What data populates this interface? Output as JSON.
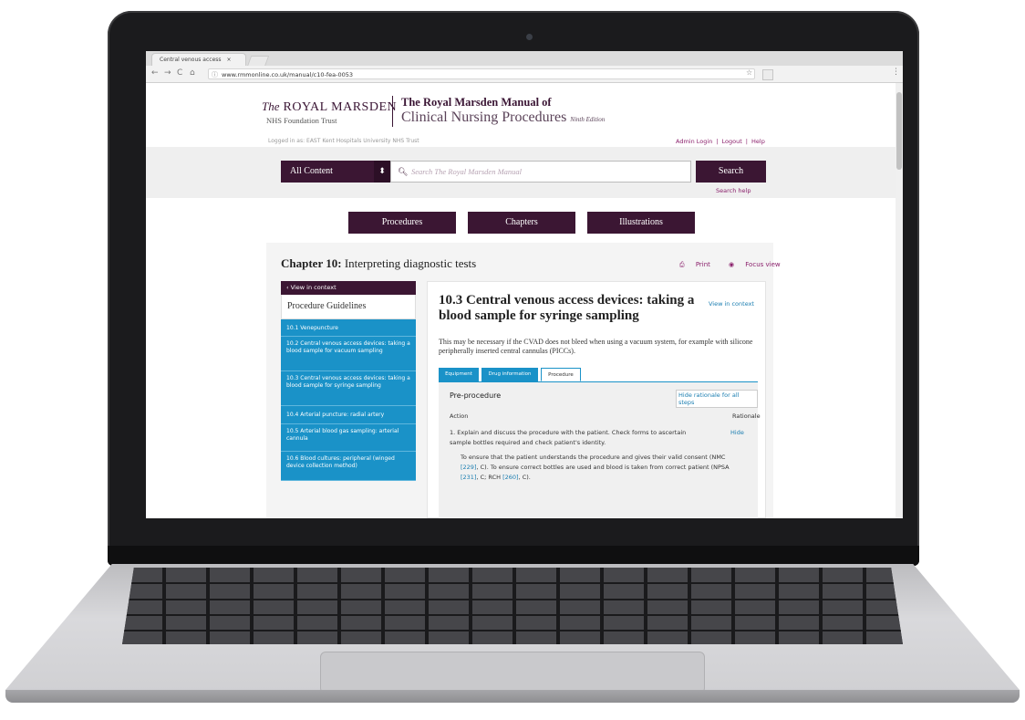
{
  "browser": {
    "tab_title": "Central venous access",
    "tab_close": "×",
    "url": "www.rmmonline.co.uk/manual/c10-fea-0053",
    "back": "←",
    "forward": "→",
    "reload": "C",
    "home": "⌂",
    "star": "☆",
    "menu": "⋮"
  },
  "header": {
    "brand_the": "The",
    "brand_name": "ROYAL MARSDEN",
    "trust": "NHS Foundation Trust",
    "manual_line1": "The Royal Marsden Manual of",
    "manual_line2": "Clinical Nursing Procedures",
    "edition": "Ninth Edition",
    "logged_in": "Logged in as: EAST Kent Hospitals University NHS Trust",
    "admin_login": "Admin Login",
    "logout": "Logout",
    "help": "Help",
    "sep": "|"
  },
  "search": {
    "scope": "All Content",
    "placeholder": "Search The Royal Marsden Manual",
    "button": "Search",
    "help": "Search help"
  },
  "nav": {
    "procedures": "Procedures",
    "chapters": "Chapters",
    "illustrations": "Illustrations"
  },
  "chapter": {
    "label": "Chapter 10:",
    "title": "Interpreting diagnostic tests",
    "print": "Print",
    "focus": "Focus view"
  },
  "sidebar": {
    "context": "View in context",
    "title": "Procedure Guidelines",
    "items": [
      "10.1 Venepuncture",
      "10.2 Central venous access devices: taking a blood sample for vacuum sampling",
      "10.3 Central venous access devices: taking a blood sample for syringe sampling",
      "10.4 Arterial puncture: radial artery",
      "10.5 Arterial blood gas sampling: arterial cannula",
      "10.6 Blood cultures: peripheral (winged device collection method)"
    ]
  },
  "article": {
    "title": "10.3 Central venous access devices: taking a blood sample for syringe sampling",
    "view_context": "View in context",
    "description": "This may be necessary if the CVAD does not bleed when using a vacuum system, for example with silicone peripherally inserted central cannulas (PICCs).",
    "tabs": [
      "Equipment",
      "Drug information",
      "Procedure"
    ],
    "pre_procedure": "Pre-procedure",
    "hide_all": "Hide rationale for all steps",
    "action_header": "Action",
    "rationale_header": "Rationale",
    "step1_action": "1. Explain and discuss the procedure with the patient. Check forms to ascertain sample bottles required and check patient's identity.",
    "step1_hide": "Hide",
    "step1_rationale_a": "To ensure that the patient understands the procedure and gives their valid consent (NMC ",
    "ref1": "[229]",
    "step1_rationale_b": ", C). To ensure correct bottles are used and blood is taken from correct patient (NPSA ",
    "ref2": "[231]",
    "step1_rationale_c": ", C; RCH ",
    "ref3": "[260]",
    "step1_rationale_d": ", C)."
  },
  "colors": {
    "brand_purple": "#3b1633",
    "sidebar_blue": "#1a92c8",
    "link_blue": "#1a7db0",
    "link_purple": "#8a1f6b"
  }
}
